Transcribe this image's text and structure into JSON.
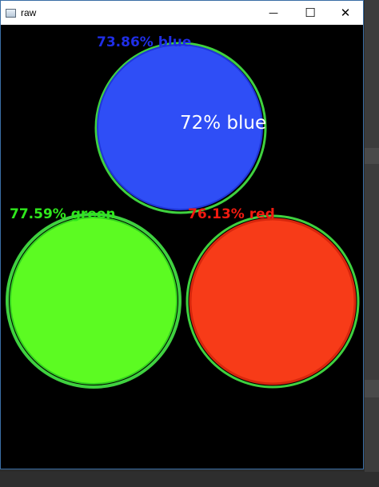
{
  "window": {
    "title": "raw",
    "minimize_glyph": "—",
    "maximize_glyph": "☐",
    "close_glyph": "✕",
    "app_icon": "window-app-icon",
    "frame_accent": "#3a6ea5"
  },
  "canvas": {
    "background": "#000000",
    "outline_color": "#3fd13f",
    "circles": [
      {
        "name": "blue",
        "fill": "#2f4ef6",
        "stroke": "#1f36d8"
      },
      {
        "name": "green",
        "fill": "#5cfb22",
        "stroke": "#33d11e"
      },
      {
        "name": "red",
        "fill": "#f73b18",
        "stroke": "#d8260c"
      }
    ],
    "labels": {
      "blue": {
        "text": "73.86% blue",
        "color": "#1f2ee6"
      },
      "green": {
        "text": "77.59% green",
        "color": "#2fe81c"
      },
      "red": {
        "text": "76.13% red",
        "color": "#f21a10"
      },
      "center": {
        "text": "72% blue",
        "color": "#ffffff"
      }
    }
  }
}
